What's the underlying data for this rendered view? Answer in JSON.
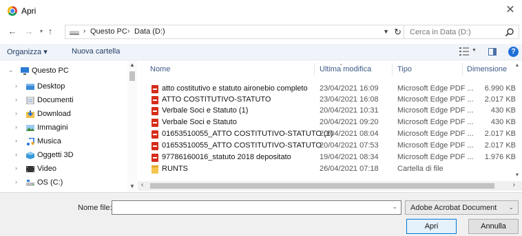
{
  "window": {
    "title": "Apri",
    "close_glyph": "✕"
  },
  "nav": {
    "back_glyph": "←",
    "forward_glyph": "→",
    "recent_glyph": "▾",
    "up_glyph": "↑",
    "breadcrumb": [
      "Questo PC",
      "Data (D:)"
    ],
    "sep_glyph": "›",
    "search_placeholder": "Cerca in Data (D:)"
  },
  "commandbar": {
    "organize_label": "Organizza ▾",
    "new_folder_label": "Nuova cartella",
    "help_glyph": "?"
  },
  "tree": [
    {
      "label": "Questo PC",
      "icon": "pc-icon",
      "expanded": true,
      "level": 0
    },
    {
      "label": "Desktop",
      "icon": "desktop-icon",
      "level": 1
    },
    {
      "label": "Documenti",
      "icon": "documents-icon",
      "level": 1
    },
    {
      "label": "Download",
      "icon": "download-icon",
      "level": 1
    },
    {
      "label": "Immagini",
      "icon": "pictures-icon",
      "level": 1
    },
    {
      "label": "Musica",
      "icon": "music-icon",
      "level": 1
    },
    {
      "label": "Oggetti 3D",
      "icon": "objects3d-icon",
      "level": 1
    },
    {
      "label": "Video",
      "icon": "video-icon",
      "level": 1
    },
    {
      "label": "OS (C:)",
      "icon": "drive-icon",
      "level": 1
    }
  ],
  "columns": {
    "name": "Nome",
    "modified": "Ultima modifica",
    "type": "Tipo",
    "size": "Dimensione"
  },
  "files": [
    {
      "name": "atto costitutivo e statuto aironebio completo",
      "modified": "23/04/2021 16:09",
      "type": "Microsoft Edge PDF ...",
      "size": "6.990 KB",
      "icon": "pdf-icon"
    },
    {
      "name": "ATTO COSTITUTIVO-STATUTO",
      "modified": "23/04/2021 16:08",
      "type": "Microsoft Edge PDF ...",
      "size": "2.017 KB",
      "icon": "pdf-icon"
    },
    {
      "name": "Verbale Soci e Statuto (1)",
      "modified": "20/04/2021 10:31",
      "type": "Microsoft Edge PDF ...",
      "size": "430 KB",
      "icon": "pdf-icon"
    },
    {
      "name": "Verbale Soci e Statuto",
      "modified": "20/04/2021 09:20",
      "type": "Microsoft Edge PDF ...",
      "size": "430 KB",
      "icon": "pdf-icon"
    },
    {
      "name": "01653510055_ATTO COSTITUTIVO-STATUTO (1)",
      "modified": "20/04/2021 08:04",
      "type": "Microsoft Edge PDF ...",
      "size": "2.017 KB",
      "icon": "pdf-icon"
    },
    {
      "name": "01653510055_ATTO COSTITUTIVO-STATUTO",
      "modified": "20/04/2021 07:53",
      "type": "Microsoft Edge PDF ...",
      "size": "2.017 KB",
      "icon": "pdf-icon"
    },
    {
      "name": "97786160016_statuto 2018 depositato",
      "modified": "19/04/2021 08:34",
      "type": "Microsoft Edge PDF ...",
      "size": "1.976 KB",
      "icon": "pdf-icon"
    },
    {
      "name": "RUNTS",
      "modified": "26/04/2021 07:18",
      "type": "Cartella di file",
      "size": "",
      "icon": "folder-icon"
    }
  ],
  "footer": {
    "filename_label": "Nome file:",
    "filename_value": "",
    "filetype_value": "Adobe Acrobat Document",
    "open_label": "Apri",
    "cancel_label": "Annulla"
  },
  "colors": {
    "accent": "#0078d7",
    "header_text": "#3c5a86",
    "pdf_red": "#d62c1a",
    "folder_yellow": "#f4c44e"
  }
}
